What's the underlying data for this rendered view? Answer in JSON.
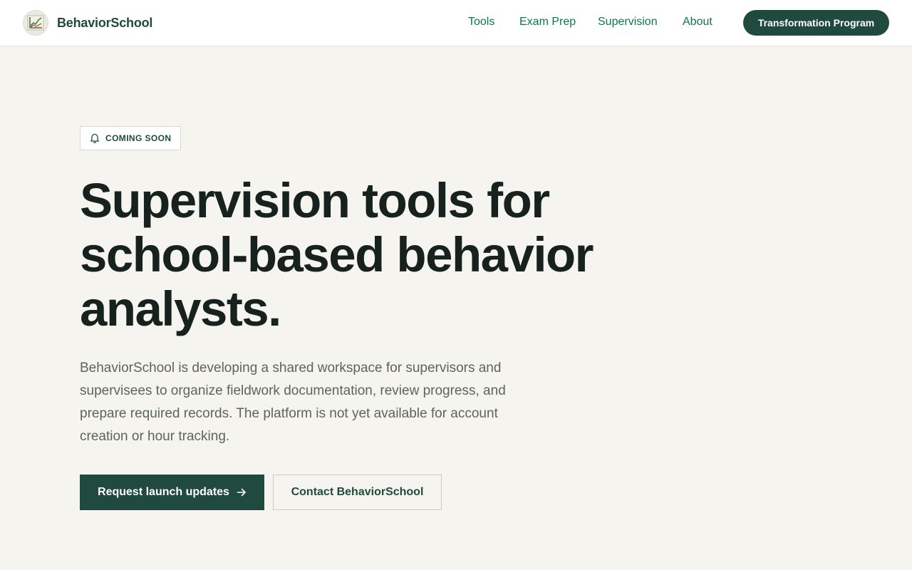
{
  "header": {
    "brand_name": "BehaviorSchool",
    "logo_icon": "chart-icon",
    "nav": [
      {
        "label": "Tools"
      },
      {
        "label": "Exam Prep"
      },
      {
        "label": "Supervision"
      },
      {
        "label": "About"
      }
    ],
    "cta_label": "Transformation Program"
  },
  "hero": {
    "badge_icon": "bell-icon",
    "badge_label": "COMING SOON",
    "headline": "Supervision tools for school-based behavior analysts.",
    "description": "BehaviorSchool is developing a shared workspace for supervisors and supervisees to organize fieldwork documentation, review progress, and prepare required records. The platform is not yet available for account creation or hour tracking.",
    "primary_button": "Request launch updates",
    "primary_button_icon": "arrow-right-icon",
    "secondary_button": "Contact BehaviorSchool"
  },
  "colors": {
    "brand_dark": "#1f4a3d",
    "nav_link": "#15724f",
    "page_bg": "#f5f4ef",
    "headline": "#17221e",
    "body_text": "#5d645f"
  }
}
